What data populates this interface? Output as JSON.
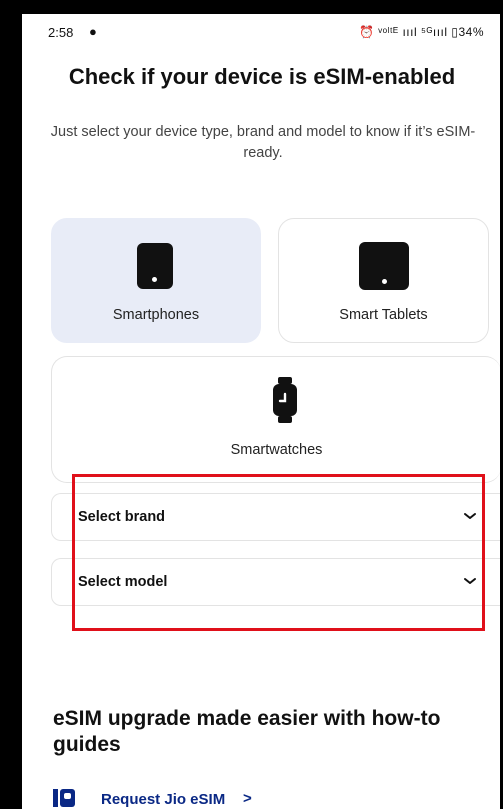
{
  "status_bar": {
    "time": "2:58",
    "right_indicators": "⏰ ᵛᵒˡᵗᴱ ıııl ⁵ᴳıııl ▯34%"
  },
  "header": {
    "title": "Check if your device is eSIM-enabled",
    "subtitle": "Just select your device type, brand and model to know if it’s eSIM-ready."
  },
  "device_types": {
    "smartphones": "Smartphones",
    "tablets": "Smart Tablets",
    "smartwatches": "Smartwatches",
    "selected": "Smartphones"
  },
  "selectors": {
    "brand": "Select brand",
    "model": "Select model"
  },
  "guides": {
    "title": "eSIM upgrade made easier with how-to guides",
    "link_label": "Request Jio eSIM",
    "link_arrow": ">"
  },
  "colors": {
    "selected_card_bg": "#e8ecf7",
    "highlight_border": "#e0101a",
    "link_color": "#0a2885"
  }
}
